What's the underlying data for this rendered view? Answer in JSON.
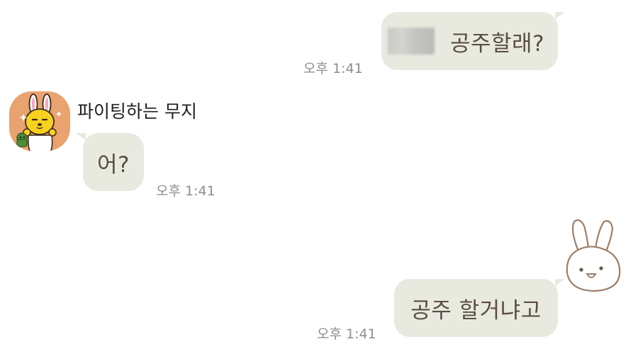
{
  "messages": [
    {
      "direction": "out",
      "text": "공주할래?",
      "time": "오후 1:41",
      "has_blurred_name": true
    },
    {
      "direction": "in",
      "sender": "파이팅하는 무지",
      "text": "어?",
      "time": "오후 1:41",
      "avatar_icon": "muzi-bunny-avatar-icon"
    },
    {
      "direction": "out",
      "text": "공주 할거냐고",
      "time": "오후 1:41",
      "emoticon": "white-bunny-emoticon-icon"
    }
  ],
  "colors": {
    "background": "#ffffff",
    "bubble": "#e8eae0",
    "bubble_text": "#5b4d44",
    "timestamp": "#8e8e8e",
    "avatar_bg": "#e9a36f"
  }
}
